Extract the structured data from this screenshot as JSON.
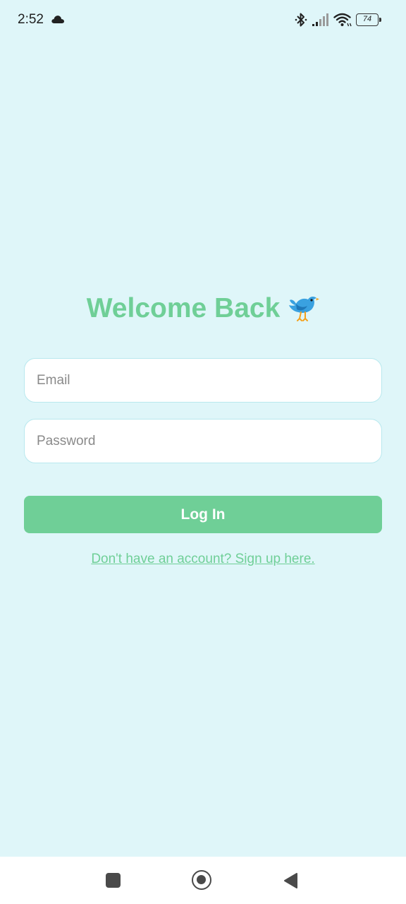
{
  "status_bar": {
    "time": "2:52",
    "battery": "74",
    "icons": [
      "cloud-icon",
      "bluetooth-icon",
      "signal-icon",
      "wifi-icon",
      "battery-icon"
    ]
  },
  "login": {
    "title": "Welcome Back",
    "title_icon": "bird-icon",
    "email_placeholder": "Email",
    "email_value": "",
    "password_placeholder": "Password",
    "password_value": "",
    "login_label": "Log In",
    "signup_link": "Don't have an account? Sign up here."
  },
  "nav_bar": {
    "icons": [
      "recents-square-icon",
      "home-circle-icon",
      "back-triangle-icon"
    ]
  },
  "colors": {
    "background": "#dff6f9",
    "accent": "#6fcf97",
    "input_border": "#b8e8ee"
  }
}
